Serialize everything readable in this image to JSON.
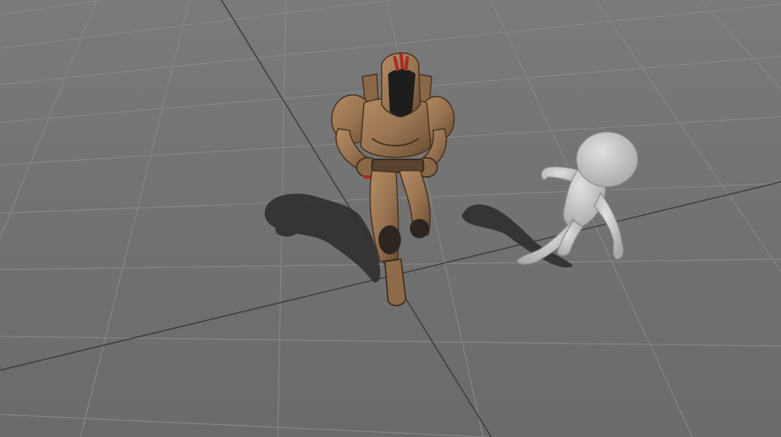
{
  "scene": {
    "view": "3d-viewport",
    "ground": {
      "type": "grid-plane",
      "floor_color": "#6f6f6f",
      "grid_line_color": "#7c7c7c",
      "major_line_color": "#3e3e3e"
    },
    "characters": [
      {
        "name": "armored-soldier",
        "pose": "walking",
        "armor_color": "#9a7552",
        "accent_color": "#a82a25",
        "visor_color": "#1d1d1d"
      },
      {
        "name": "mannequin",
        "pose": "running",
        "body_color": "#c9c9c9"
      }
    ],
    "shadow_color": "#2c2c2c"
  }
}
